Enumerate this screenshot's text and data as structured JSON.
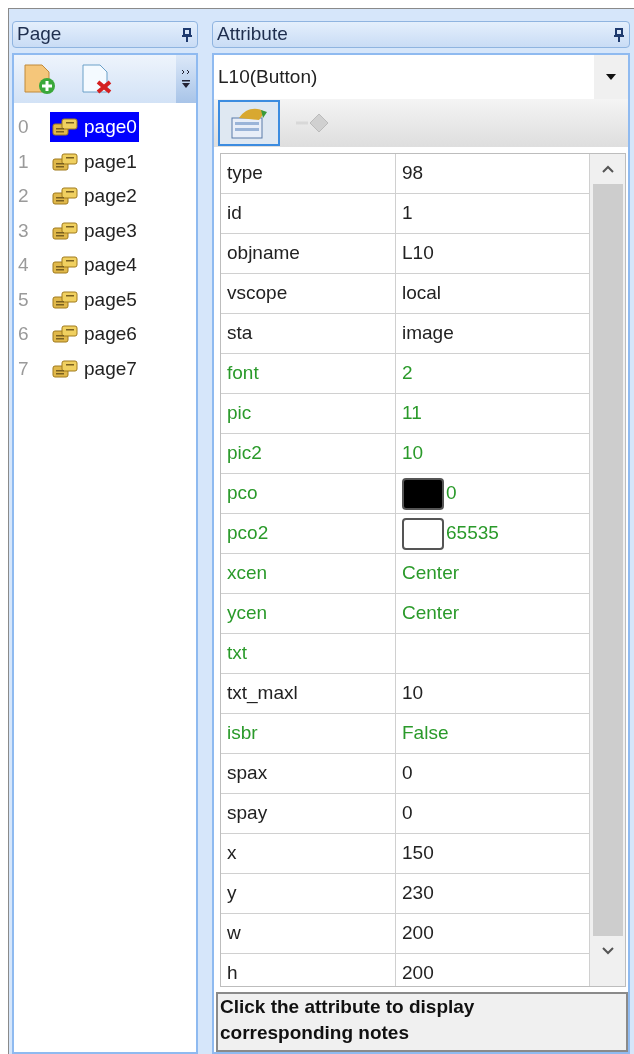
{
  "page_panel": {
    "title": "Page",
    "pages": [
      {
        "index": "0",
        "name": "page0",
        "selected": true
      },
      {
        "index": "1",
        "name": "page1",
        "selected": false
      },
      {
        "index": "2",
        "name": "page2",
        "selected": false
      },
      {
        "index": "3",
        "name": "page3",
        "selected": false
      },
      {
        "index": "4",
        "name": "page4",
        "selected": false
      },
      {
        "index": "5",
        "name": "page5",
        "selected": false
      },
      {
        "index": "6",
        "name": "page6",
        "selected": false
      },
      {
        "index": "7",
        "name": "page7",
        "selected": false
      }
    ]
  },
  "attribute_panel": {
    "title": "Attribute",
    "object_select": {
      "value": "L10(Button)"
    },
    "attributes": [
      {
        "name": "type",
        "value": "98",
        "editable": false
      },
      {
        "name": "id",
        "value": "1",
        "editable": false
      },
      {
        "name": "objname",
        "value": "L10",
        "editable": false
      },
      {
        "name": "vscope",
        "value": "local",
        "editable": false
      },
      {
        "name": "sta",
        "value": "image",
        "editable": false
      },
      {
        "name": "font",
        "value": "2",
        "editable": true
      },
      {
        "name": "pic",
        "value": "11",
        "editable": true
      },
      {
        "name": "pic2",
        "value": "10",
        "editable": true
      },
      {
        "name": "pco",
        "value": "0",
        "editable": true,
        "color": "#000000"
      },
      {
        "name": "pco2",
        "value": "65535",
        "editable": true,
        "color": "#ffffff"
      },
      {
        "name": "xcen",
        "value": "Center",
        "editable": true
      },
      {
        "name": "ycen",
        "value": "Center",
        "editable": true
      },
      {
        "name": "txt",
        "editable": true
      },
      {
        "name": "txt_maxl",
        "value": "10",
        "editable": false
      },
      {
        "name": "isbr",
        "value": "False",
        "editable": true
      },
      {
        "name": "spax",
        "value": "0",
        "editable": false
      },
      {
        "name": "spay",
        "value": "0",
        "editable": false
      },
      {
        "name": "x",
        "value": "150",
        "editable": false
      },
      {
        "name": "y",
        "value": "230",
        "editable": false
      },
      {
        "name": "w",
        "value": "200",
        "editable": false
      },
      {
        "name": "h",
        "value": "200",
        "editable": false
      }
    ],
    "notes": "Click the attribute to display corresponding notes"
  }
}
